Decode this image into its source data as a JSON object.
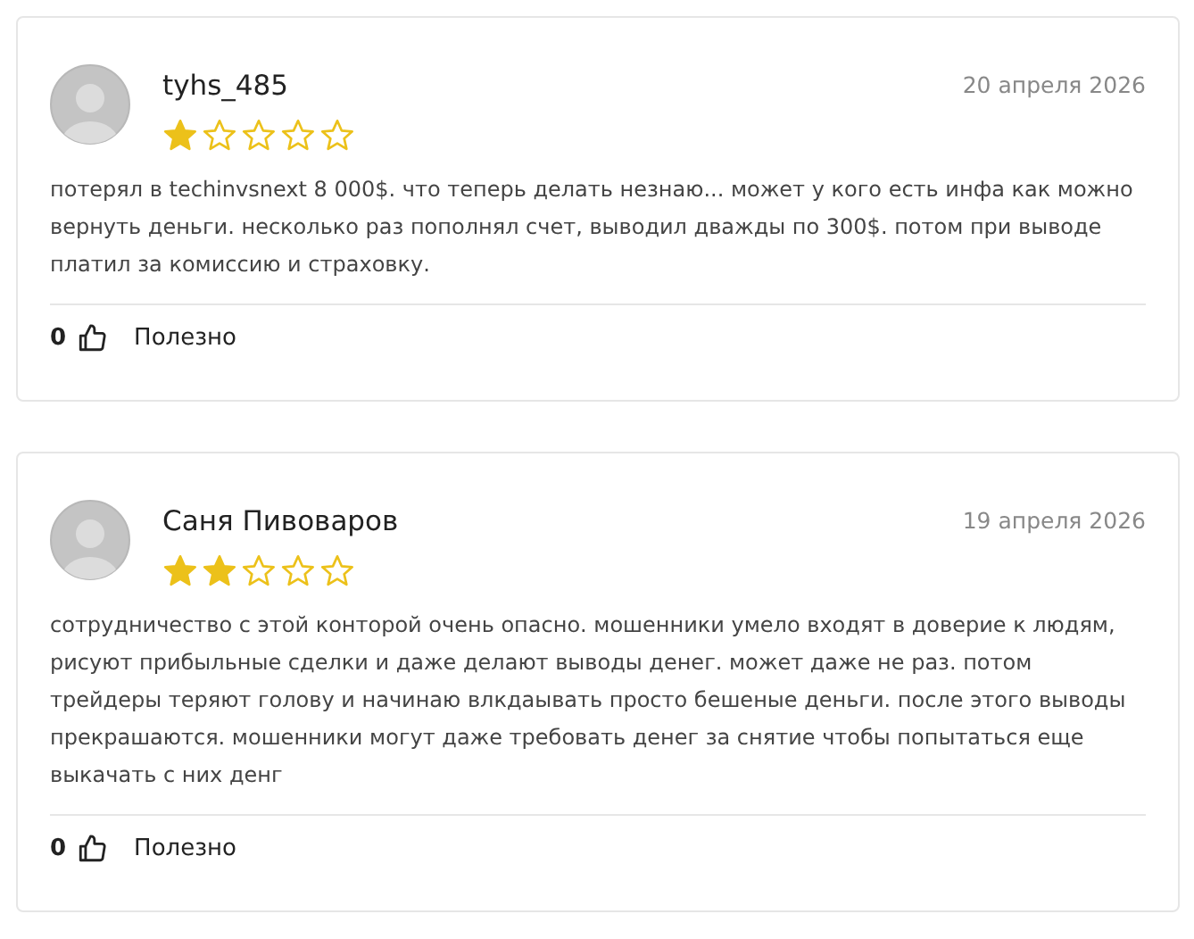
{
  "reviews": [
    {
      "author": "tyhs_485",
      "date": "20 апреля 2026",
      "stars": 1,
      "text": "потерял в techinvsnext 8 000$. что теперь делать незнаю... может у кого есть инфа как можно вернуть деньги. несколько раз пополнял счет, выводил дважды по 300$. потом при выводе платил за комиссию и страховку.",
      "likes": "0",
      "helpful": "Полезно"
    },
    {
      "author": "Саня Пивоваров",
      "date": "19 апреля 2026",
      "stars": 2,
      "text": "сотрудничество с этой конторой очень опасно. мошенники умело входят в доверие к людям, рисуют прибыльные сделки и даже делают выводы денег. может даже не раз. потом трейдеры теряют голову и начинаю влкдаывать просто бешеные деньги. после этого выводы прекрашаются. мошенники могут даже требовать денег за снятие чтобы попытаться еще выкачать с них денг",
      "likes": "0",
      "helpful": "Полезно"
    }
  ]
}
